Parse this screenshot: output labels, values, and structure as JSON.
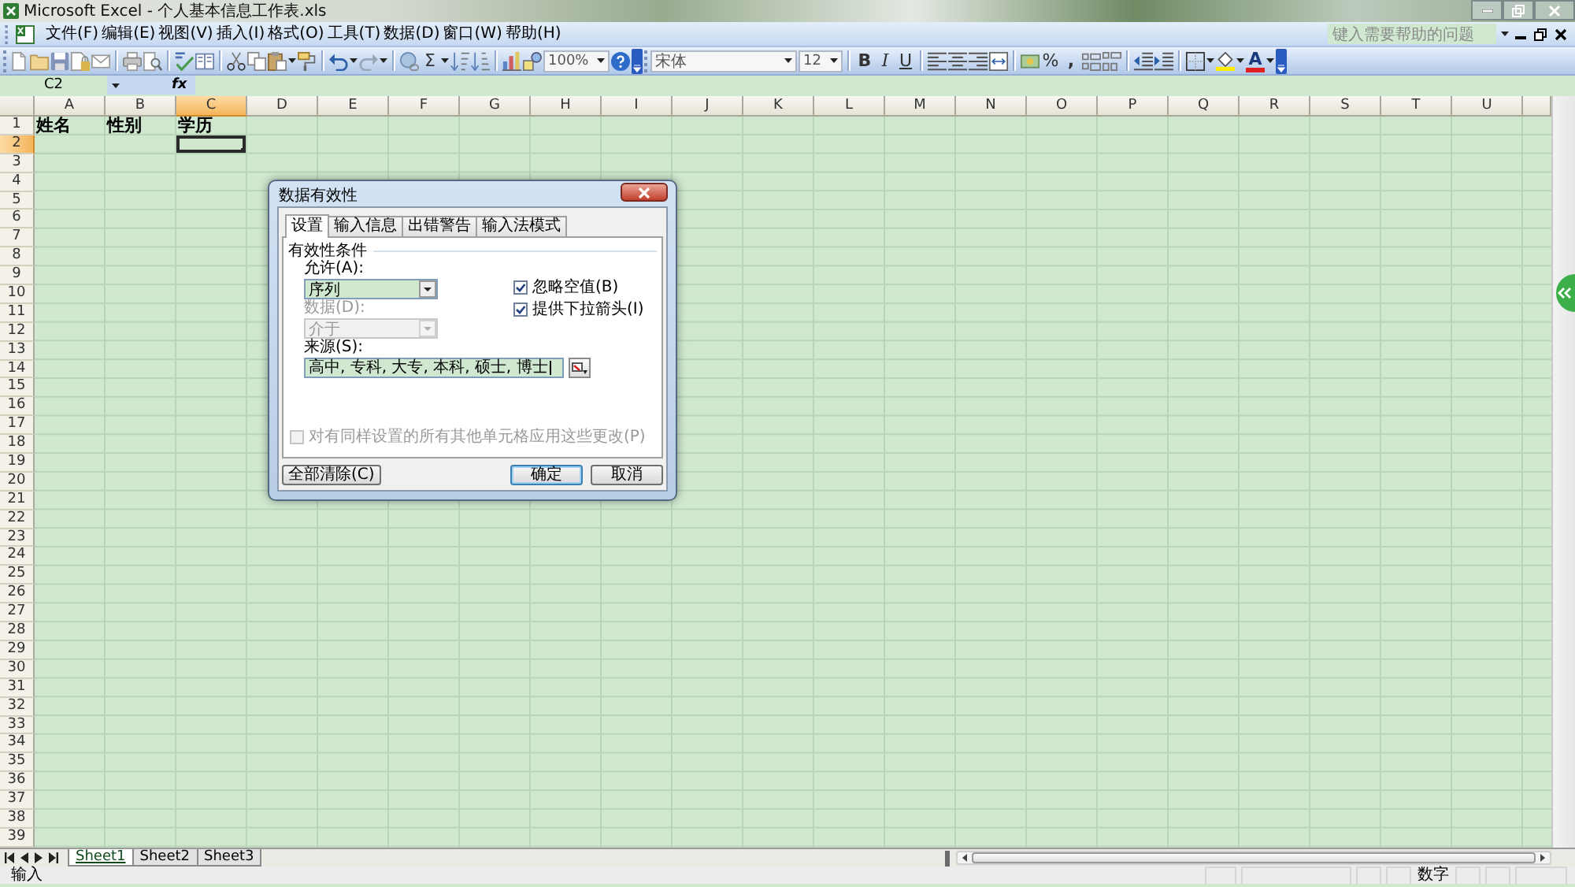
{
  "window": {
    "title": "Microsoft Excel - 个人基本信息工作表.xls"
  },
  "menu_bar": {
    "items": [
      "文件(F)",
      "编辑(E)",
      "视图(V)",
      "插入(I)",
      "格式(O)",
      "工具(T)",
      "数据(D)",
      "窗口(W)",
      "帮助(H)"
    ],
    "help_field": {
      "placeholder": "键入需要帮助的问题"
    }
  },
  "toolbar": {
    "autosum": "Σ",
    "zoom": "100%",
    "font": "宋体",
    "font_size": "12",
    "bold": "B",
    "italic": "I",
    "underline": "U",
    "percent": "%",
    "comma": ",",
    "font_color": "A"
  },
  "formula_bar": {
    "name_box": "C2",
    "function_label": "fx"
  },
  "sheet": {
    "columns": [
      {
        "label": "A",
        "selected": false
      },
      {
        "label": "B",
        "selected": false
      },
      {
        "label": "C",
        "selected": true
      },
      {
        "label": "D",
        "selected": false
      },
      {
        "label": "E",
        "selected": false
      },
      {
        "label": "F",
        "selected": false
      },
      {
        "label": "G",
        "selected": false
      },
      {
        "label": "H",
        "selected": false
      },
      {
        "label": "I",
        "selected": false
      },
      {
        "label": "J",
        "selected": false
      },
      {
        "label": "K",
        "selected": false
      },
      {
        "label": "L",
        "selected": false
      },
      {
        "label": "M",
        "selected": false
      },
      {
        "label": "N",
        "selected": false
      },
      {
        "label": "O",
        "selected": false
      },
      {
        "label": "P",
        "selected": false
      },
      {
        "label": "Q",
        "selected": false
      },
      {
        "label": "R",
        "selected": false
      },
      {
        "label": "S",
        "selected": false
      },
      {
        "label": "T",
        "selected": false
      },
      {
        "label": "U",
        "selected": false
      }
    ],
    "rows": [
      {
        "header": "1",
        "selected": false,
        "cells": [
          {
            "text": "姓名",
            "selected": false
          },
          {
            "text": "性别",
            "selected": false
          },
          {
            "text": "学历",
            "selected": false
          }
        ]
      },
      {
        "header": "2",
        "selected": true,
        "cells": [
          {
            "selected": false
          },
          {
            "selected": false
          },
          {
            "selected": true
          }
        ]
      },
      {
        "header": "3",
        "selected": false
      },
      {
        "header": "4",
        "selected": false
      },
      {
        "header": "5",
        "selected": false
      },
      {
        "header": "6",
        "selected": false
      },
      {
        "header": "7",
        "selected": false
      },
      {
        "header": "8",
        "selected": false
      },
      {
        "header": "9",
        "selected": false
      },
      {
        "header": "10",
        "selected": false
      },
      {
        "header": "11",
        "selected": false
      },
      {
        "header": "12",
        "selected": false
      },
      {
        "header": "13",
        "selected": false
      },
      {
        "header": "14",
        "selected": false
      },
      {
        "header": "15",
        "selected": false
      },
      {
        "header": "16",
        "selected": false
      },
      {
        "header": "17",
        "selected": false
      },
      {
        "header": "18",
        "selected": false
      },
      {
        "header": "19",
        "selected": false
      },
      {
        "header": "20",
        "selected": false
      },
      {
        "header": "21",
        "selected": false
      },
      {
        "header": "22",
        "selected": false
      },
      {
        "header": "23",
        "selected": false
      },
      {
        "header": "24",
        "selected": false
      },
      {
        "header": "25",
        "selected": false
      },
      {
        "header": "26",
        "selected": false
      },
      {
        "header": "27",
        "selected": false
      },
      {
        "header": "28",
        "selected": false
      },
      {
        "header": "29",
        "selected": false
      },
      {
        "header": "30",
        "selected": false
      },
      {
        "header": "31",
        "selected": false
      },
      {
        "header": "32",
        "selected": false
      },
      {
        "header": "33",
        "selected": false
      },
      {
        "header": "34",
        "selected": false
      },
      {
        "header": "35",
        "selected": false
      },
      {
        "header": "36",
        "selected": false
      },
      {
        "header": "37",
        "selected": false
      },
      {
        "header": "38",
        "selected": false
      },
      {
        "header": "39",
        "selected": false
      }
    ]
  },
  "dialog": {
    "title": "数据有效性",
    "tabs": [
      {
        "label": "设置",
        "selected": true
      },
      {
        "label": "输入信息",
        "selected": false
      },
      {
        "label": "出错警告",
        "selected": false
      },
      {
        "label": "输入法模式",
        "selected": false
      }
    ],
    "group_label": "有效性条件",
    "allow": {
      "label": "允许(A):",
      "value": "序列",
      "disabled": false
    },
    "data": {
      "label": "数据(D):",
      "value": "介于",
      "disabled": true
    },
    "source": {
      "label": "来源(S):",
      "value": "高中, 专科, 大专, 本科, 硕士, 博士"
    },
    "options": [
      {
        "label": "忽略空值(B)",
        "checked": true,
        "disabled": false
      },
      {
        "label": "提供下拉箭头(I)",
        "checked": true,
        "disabled": false
      }
    ],
    "apply_all": {
      "label": "对有同样设置的所有其他单元格应用这些更改(P)",
      "checked": false,
      "disabled": true
    },
    "clear_button": "全部清除(C)",
    "buttons": [
      {
        "label": "确定",
        "default": true
      },
      {
        "label": "取消",
        "default": false
      }
    ]
  },
  "sheet_tabs": [
    {
      "label": "Sheet1",
      "selected": true
    },
    {
      "label": "Sheet2",
      "selected": false
    },
    {
      "label": "Sheet3",
      "selected": false
    }
  ],
  "status_bar": {
    "mode": "输入",
    "num_indicator": "数字"
  }
}
